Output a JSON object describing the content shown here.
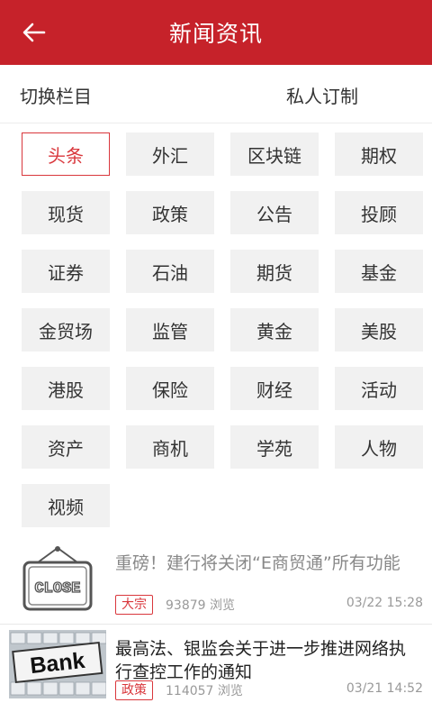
{
  "header": {
    "title": "新闻资讯",
    "back_icon": "arrow-left-icon"
  },
  "subnav": {
    "left_label": "切换栏目",
    "right_label": "私人订制"
  },
  "categories": [
    "头条",
    "外汇",
    "区块链",
    "期权",
    "现货",
    "政策",
    "公告",
    "投顾",
    "证券",
    "石油",
    "期货",
    "基金",
    "金贸场",
    "监管",
    "黄金",
    "美股",
    "港股",
    "保险",
    "财经",
    "活动",
    "资产",
    "商机",
    "学苑",
    "人物",
    "视频"
  ],
  "active_category": "头条",
  "news": [
    {
      "title": "重磅！建行将关闭“E商贸通”所有功能",
      "tag": "大宗",
      "views": "93879 浏览",
      "date": "03/22 15:28",
      "thumb_text": "CLOSE"
    },
    {
      "title": "最高法、银监会关于进一步推进网络执行查控工作的通知",
      "tag": "政策",
      "views": "114057 浏览",
      "date": "03/21 14:52",
      "thumb_text": "Bank"
    }
  ],
  "colors": {
    "brand": "#c6222a",
    "accent": "#d9373c"
  }
}
